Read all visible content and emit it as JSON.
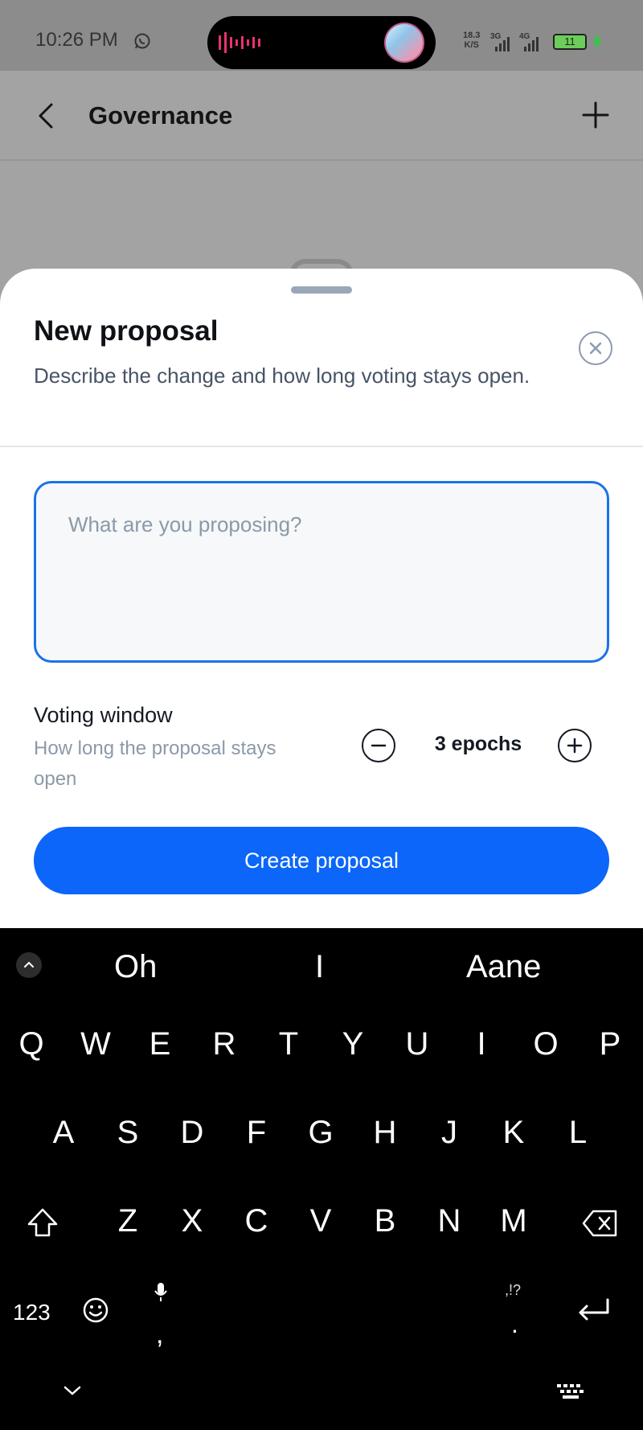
{
  "status_bar": {
    "time": "10:26 PM",
    "net_speed_value": "18.3",
    "net_speed_unit": "K/S",
    "network_1": "3G",
    "network_2": "4G",
    "battery_level": "11"
  },
  "app_bar": {
    "title": "Governance"
  },
  "sheet": {
    "title": "New proposal",
    "subtitle": "Describe the change and how long voting stays open.",
    "proposal_input": {
      "value": "",
      "placeholder": "What are you proposing?"
    },
    "voting_window": {
      "label": "Voting window",
      "description": "How long the proposal stays open",
      "value": "3 epochs"
    },
    "create_button_label": "Create proposal"
  },
  "keyboard": {
    "suggestions": [
      "Oh",
      "I",
      "Aane"
    ],
    "row1": [
      "Q",
      "W",
      "E",
      "R",
      "T",
      "Y",
      "U",
      "I",
      "O",
      "P"
    ],
    "row2": [
      "A",
      "S",
      "D",
      "F",
      "G",
      "H",
      "J",
      "K",
      "L"
    ],
    "row3": [
      "Z",
      "X",
      "C",
      "V",
      "B",
      "N",
      "M"
    ],
    "numbers_key": "123",
    "comma_key": ",",
    "period_key": ".",
    "punctuation_hint": ",!?"
  }
}
